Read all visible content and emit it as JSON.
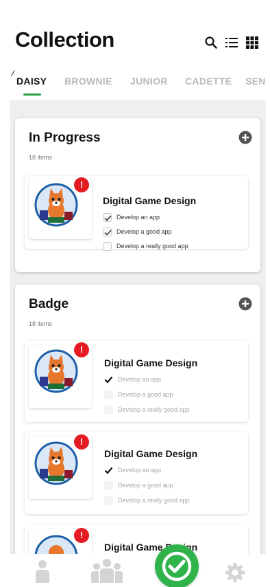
{
  "header": {
    "title": "Collection"
  },
  "tabs": [
    {
      "label": "DAISY",
      "active": true
    },
    {
      "label": "BROWNIE"
    },
    {
      "label": "JUNIOR"
    },
    {
      "label": "CADETTE"
    },
    {
      "label": "SEN"
    }
  ],
  "sections": {
    "in_progress": {
      "title": "In Progress",
      "count": "18 items",
      "items": [
        {
          "title": "Digital Game Design",
          "alert": "!",
          "requirements": [
            {
              "label": "Develop an app",
              "checked": true
            },
            {
              "label": "Develop a good app",
              "checked": true
            },
            {
              "label": "Develop a really good app",
              "checked": false
            }
          ]
        }
      ]
    },
    "badge": {
      "title": "Badge",
      "count": "18 items",
      "items": [
        {
          "title": "Digital Game Design",
          "alert": "!",
          "requirements": [
            {
              "label": "Develop an app",
              "checked": true
            },
            {
              "label": "Develop a good app",
              "checked": false
            },
            {
              "label": "Develop a really good app",
              "checked": false
            }
          ]
        },
        {
          "title": "Digital Game Design",
          "alert": "!",
          "requirements": [
            {
              "label": "Develop an app",
              "checked": true
            },
            {
              "label": "Develop a good app",
              "checked": false
            },
            {
              "label": "Develop a really good app",
              "checked": false
            }
          ]
        },
        {
          "title": "Digital Game Design",
          "alert": "!"
        }
      ]
    }
  },
  "colors": {
    "accent": "#2fb34a",
    "alert": "#e51b23",
    "text": "#111111",
    "muted": "#b9b9b9"
  },
  "icons": [
    "search-icon",
    "list-view-icon",
    "grid-view-icon",
    "add-icon",
    "profile-icon",
    "troop-icon",
    "check-icon",
    "settings-icon"
  ]
}
